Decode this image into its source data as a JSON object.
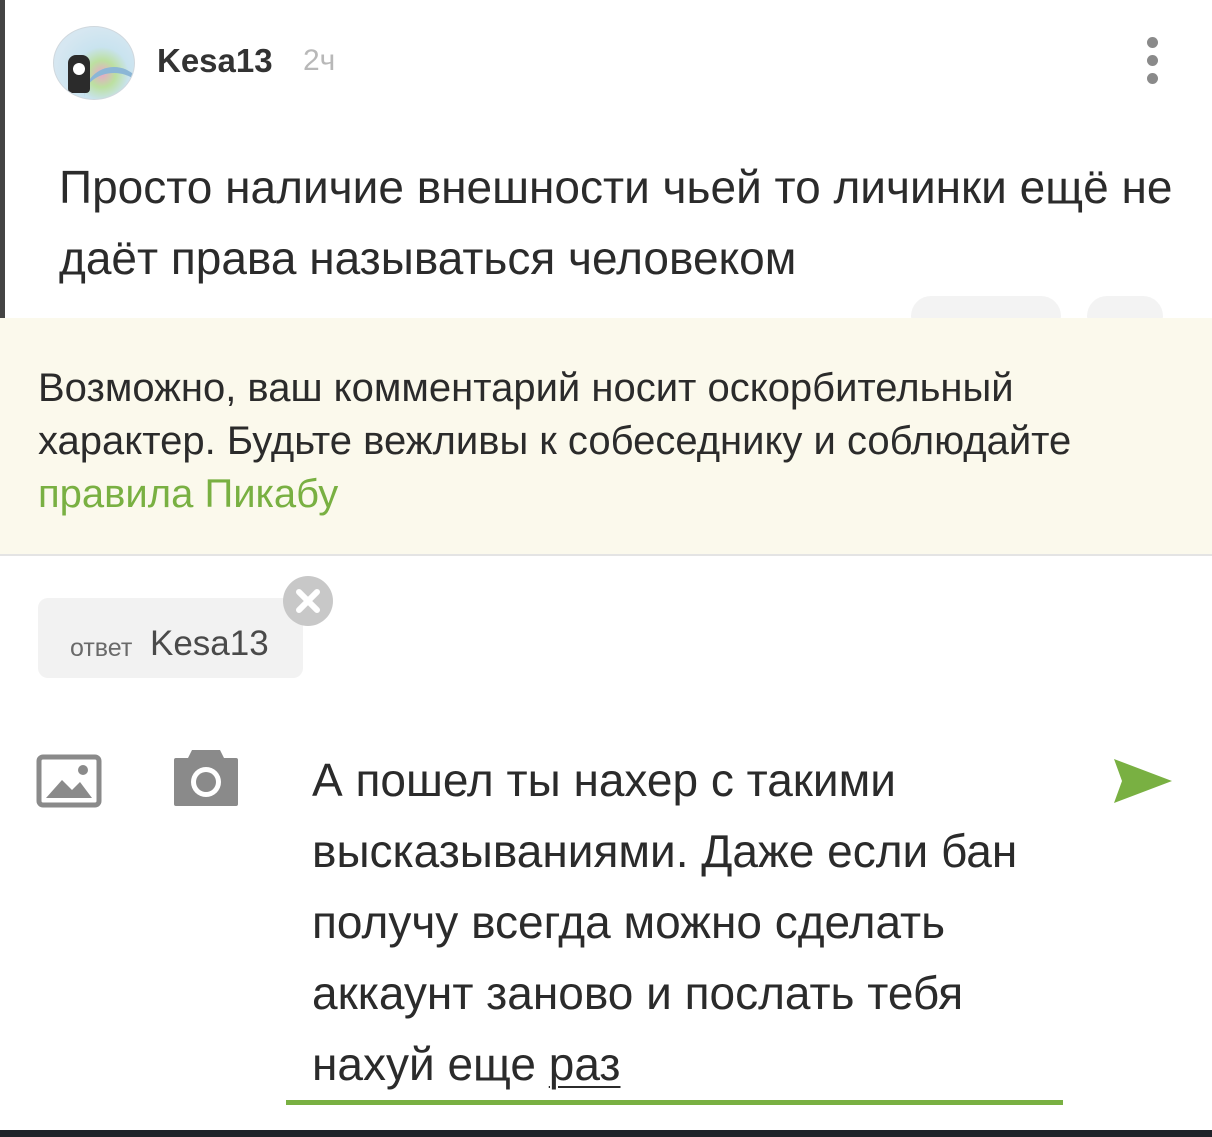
{
  "comment": {
    "username": "Kesa13",
    "time": "2ч",
    "text": "Просто наличие внешности чьей то личинки ещё не даёт права называться человеком"
  },
  "warning": {
    "text": "Возможно, ваш комментарий носит оскорбительный характер. Будьте вежливы к собеседнику и соблюдайте",
    "link_text": "правила Пикабу",
    "link_color": "#79b042",
    "background": "#fbf9ec"
  },
  "reply": {
    "prefix": "ответ",
    "username": "Kesa13"
  },
  "composer": {
    "text": "А пошел ты нахер с такими высказываниями. Даже если бан получу всегда можно сделать аккаунт заново и послать тебя нахуй еще ",
    "last_word": "раз",
    "accent_color": "#79b042",
    "icons": [
      "image-icon",
      "camera-icon",
      "send-icon"
    ]
  }
}
